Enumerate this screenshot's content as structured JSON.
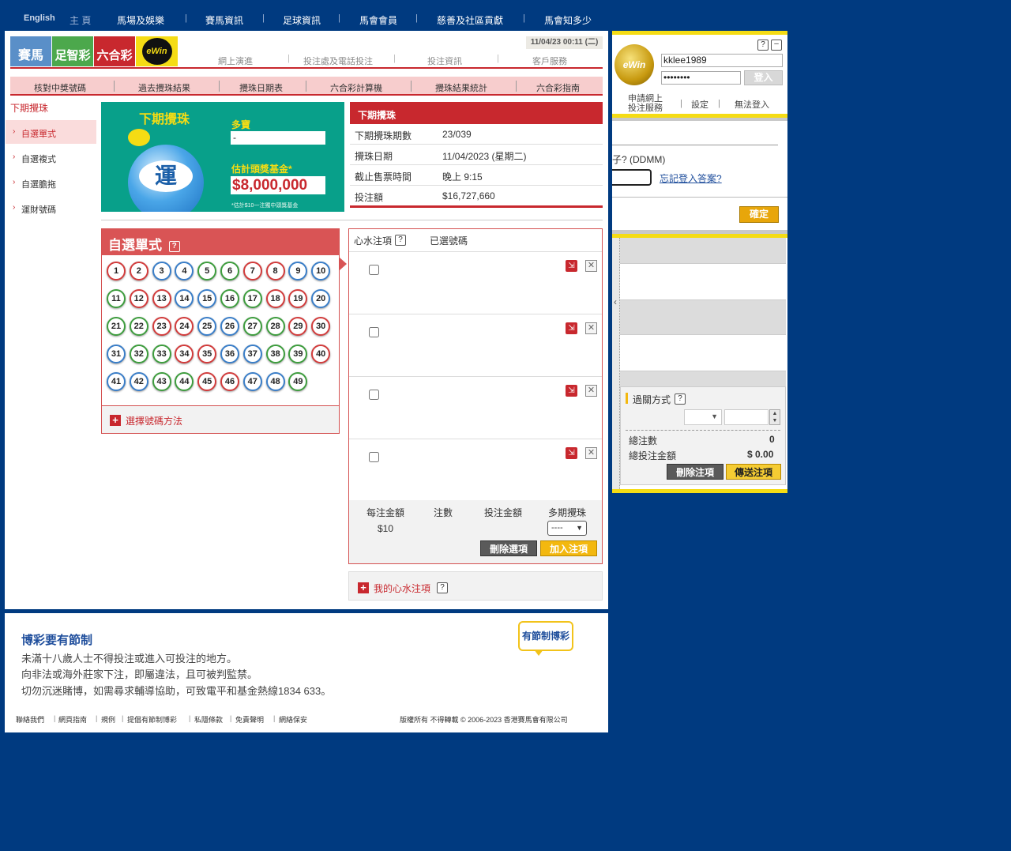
{
  "topnav": {
    "english": "English",
    "home": "主 頁",
    "items": [
      "馬場及娛樂",
      "賽馬資訊",
      "足球資訊",
      "馬會會員",
      "慈善及社區貢獻",
      "馬會知多少"
    ]
  },
  "header": {
    "tabs": [
      "賽馬",
      "足智彩",
      "六合彩"
    ],
    "ewin_logo": "eWin",
    "date": "11/04/23 00:11 (二)",
    "subnav": [
      "網上演進",
      "投注處及電話投注",
      "投注資訊",
      "客戶服務"
    ]
  },
  "subbar": {
    "items": [
      "核對中獎號碼",
      "過去攪珠結果",
      "攪珠日期表",
      "六合彩計算機",
      "攪珠結果統計",
      "六合彩指南"
    ]
  },
  "breadcrumb": "下期攪珠",
  "leftmenu": {
    "items": [
      "自選單式",
      "自選複式",
      "自選膽拖",
      "運財號碼"
    ]
  },
  "banner": {
    "title": "下期攪珠",
    "snowball_label": "多寶",
    "snowball_value": "-",
    "jackpot_label": "估計頭獎基金*",
    "jackpot_value": "$8,000,000",
    "note": "*估計$10一注獨中頭獎基金",
    "fortune_char": "運"
  },
  "drawinfo": {
    "heading": "下期攪珠",
    "rows": [
      {
        "k": "下期攪珠期數",
        "v": "23/039"
      },
      {
        "k": "攪珠日期",
        "v": "11/04/2023 (星期二)"
      },
      {
        "k": "截止售票時間",
        "v": "晚上 9:15"
      },
      {
        "k": "投注額",
        "v": "$16,727,660"
      }
    ]
  },
  "balls": {
    "heading": "自選單式",
    "numbers": [
      1,
      2,
      3,
      4,
      5,
      6,
      7,
      8,
      9,
      10,
      11,
      12,
      13,
      14,
      15,
      16,
      17,
      18,
      19,
      20,
      21,
      22,
      23,
      24,
      25,
      26,
      27,
      28,
      29,
      30,
      31,
      32,
      33,
      34,
      35,
      36,
      37,
      38,
      39,
      40,
      41,
      42,
      43,
      44,
      45,
      46,
      47,
      48,
      49
    ],
    "colors": {
      "red": "#d23c3c",
      "blue": "#3a7ec8",
      "green": "#3e9d3e"
    },
    "choose_method": "選擇號碼方法"
  },
  "selection": {
    "favourite_label": "心水注項",
    "selected_label": "已選號碼",
    "rows": 4,
    "cols": [
      "每注金額",
      "注數",
      "投注金額",
      "多期攪珠"
    ],
    "unit_amount": "$10",
    "multi_draw_value": "----",
    "delete_btn": "刪除選項",
    "add_btn": "加入注項"
  },
  "mybets": "我的心水注項",
  "footer": {
    "title": "博彩要有節制",
    "lines": [
      "未滿十八歲人士不得投注或進入可投注的地方。",
      "向非法或海外莊家下注，即屬違法，且可被判監禁。",
      "切勿沉迷賭博，如需尋求輔導協助，可致電平和基金熱線1834 633。"
    ],
    "badge": "有節制博彩",
    "links": [
      "聯絡我們",
      "網頁指南",
      "規例",
      "提倡有節制博彩",
      "私隱條款",
      "免責聲明",
      "網絡保安"
    ],
    "copyright": "版權所有 不得轉載 © 2006-2023 香港賽馬會有限公司"
  },
  "betslip": {
    "username": "kklee1989",
    "password": "••••••••",
    "login_btn": "登入",
    "register": [
      "申請網上",
      "投注服務"
    ],
    "settings": "設定",
    "cannot_login": "無法登入",
    "question": "子? (DDMM)",
    "forgot": "忘記登入答案?",
    "confirm": "確定",
    "collapse_arrow": "‹",
    "parlay_label": "過關方式",
    "total_bets_label": "總注數",
    "total_bets": "0",
    "total_amount_label": "總投注金額",
    "total_amount": "$ 0.00",
    "delete_btn": "刪除注項",
    "send_btn": "傳送注項"
  }
}
